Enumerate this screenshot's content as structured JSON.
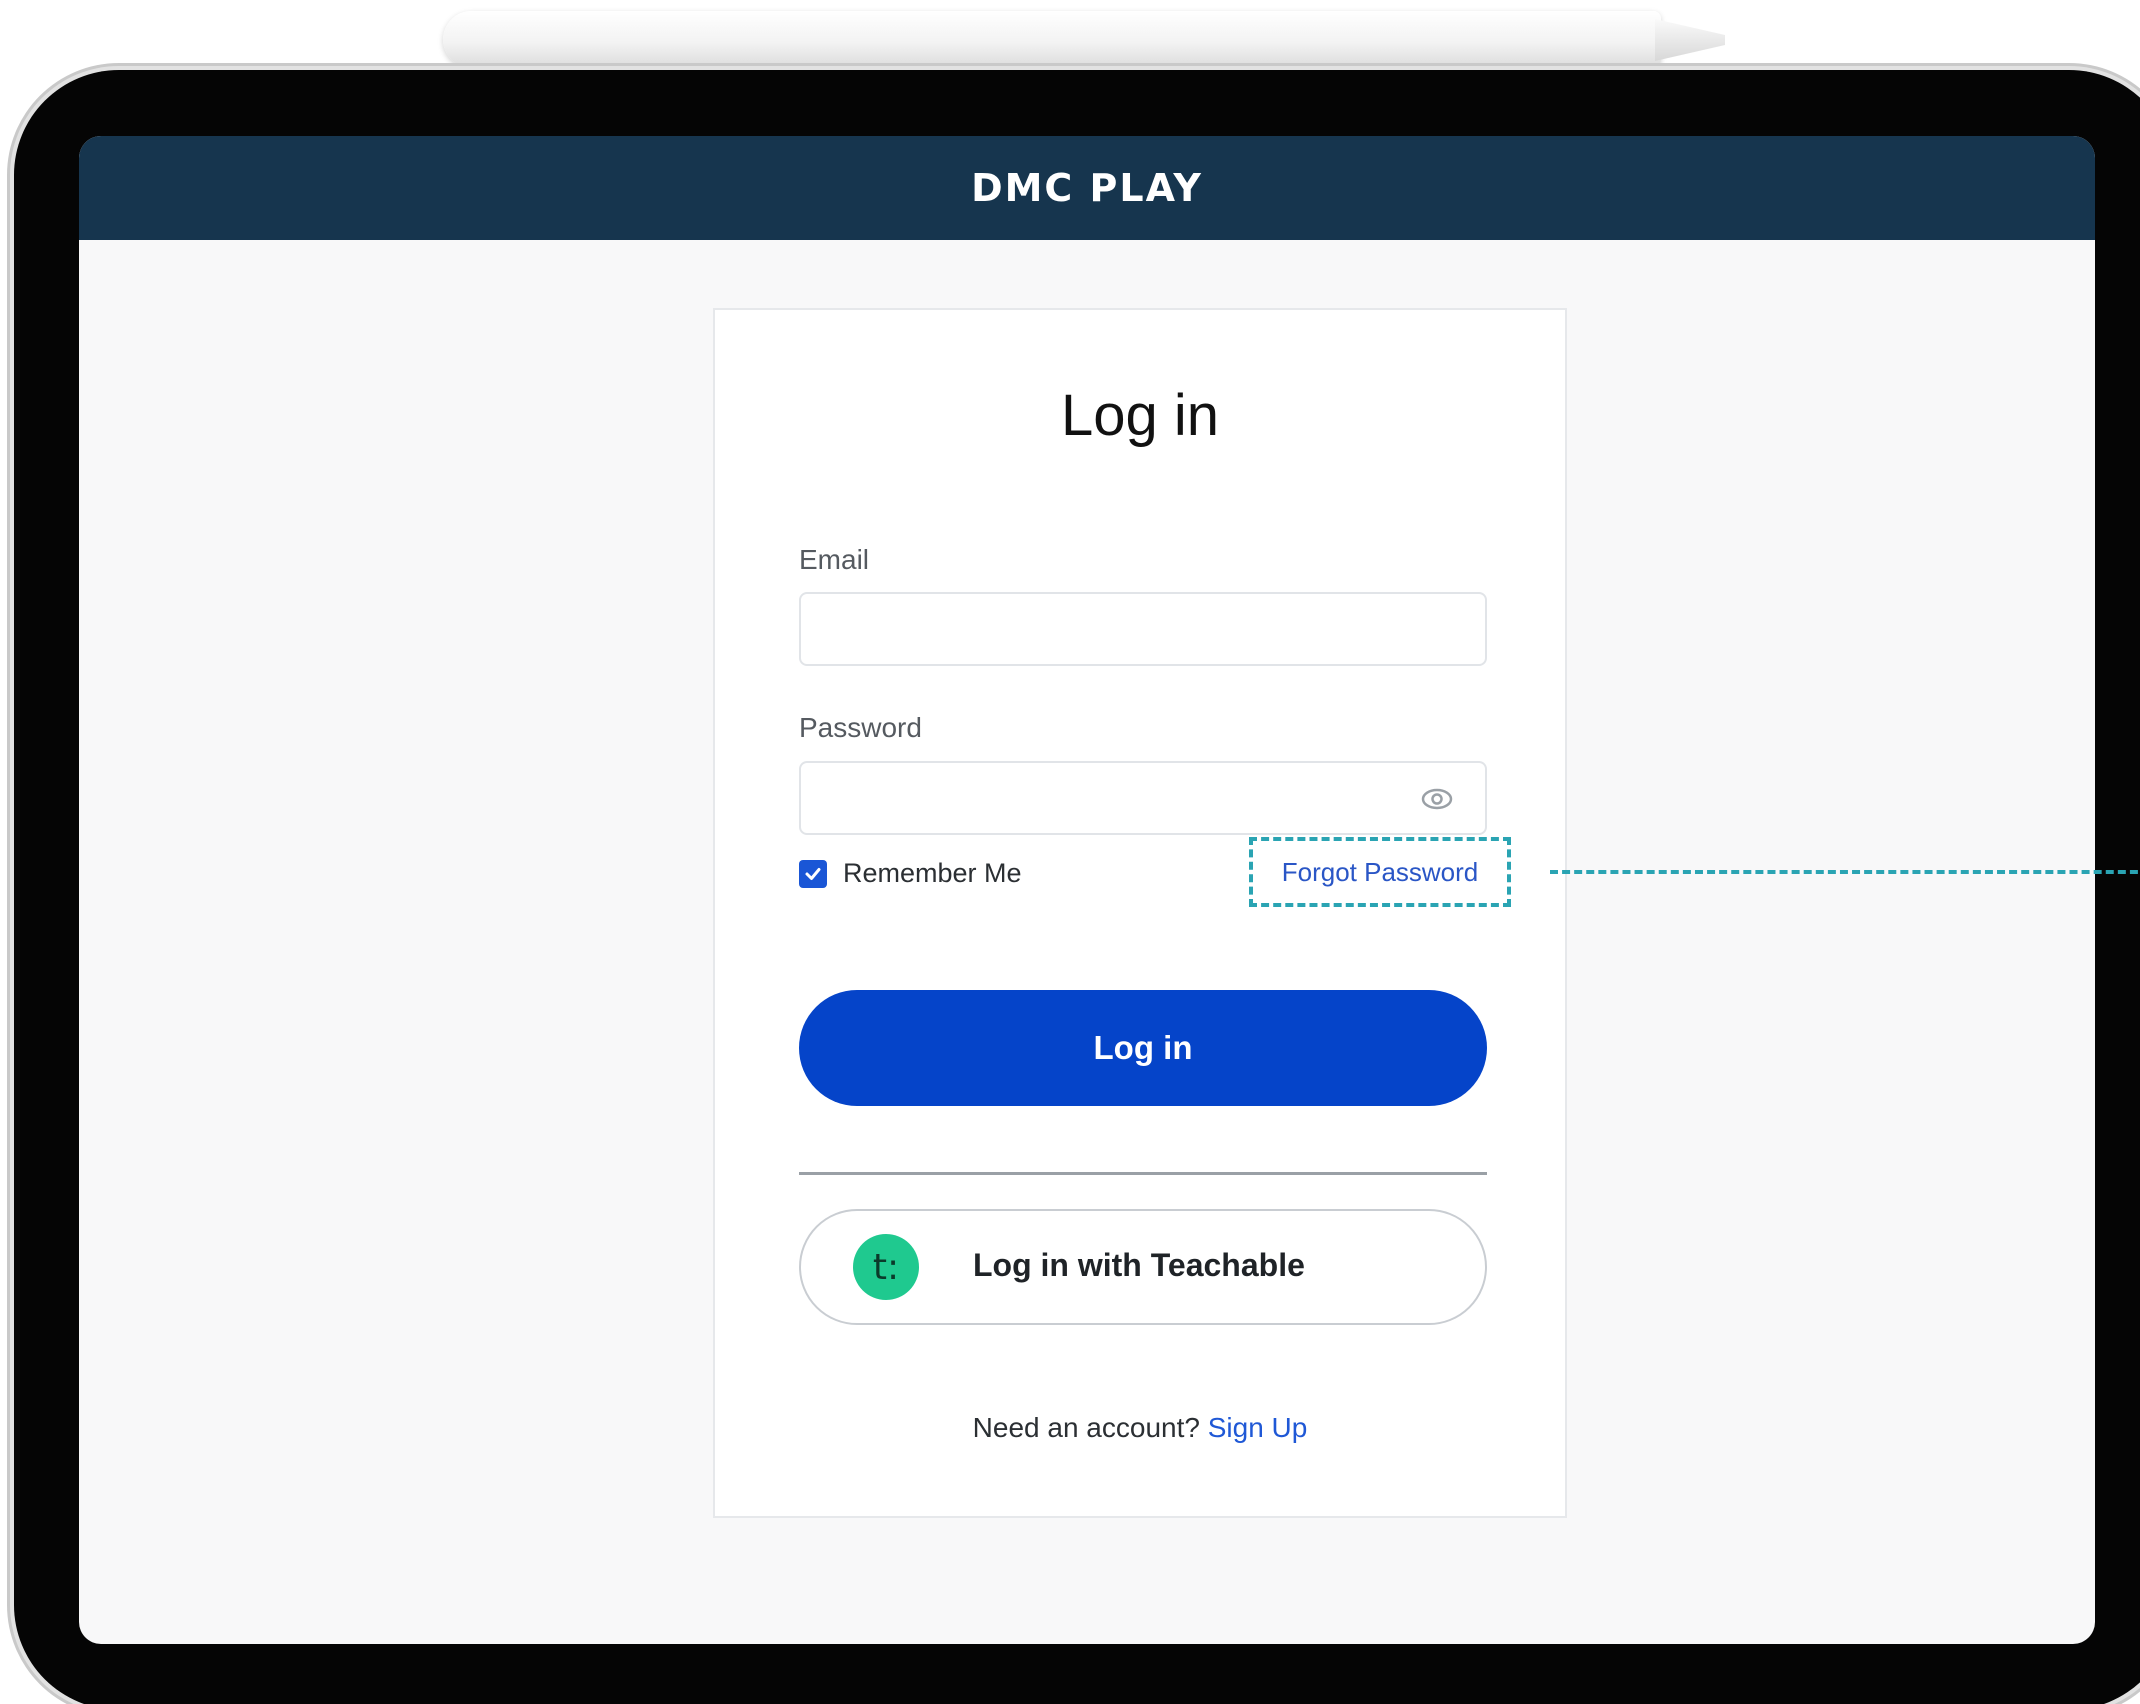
{
  "app": {
    "logo_text": "DMC PLAY"
  },
  "login_form": {
    "title": "Log in",
    "email_label": "Email",
    "email_value": "",
    "password_label": "Password",
    "password_value": "",
    "remember_me_label": "Remember Me",
    "remember_me_checked": true,
    "forgot_password_label": "Forgot Password",
    "login_button_label": "Log in",
    "teachable_icon_text": "t:",
    "teachable_button_label": "Log in with Teachable",
    "signup_prompt": "Need an account?",
    "signup_link_label": "Sign Up"
  },
  "colors": {
    "header_bg": "#16354e",
    "primary_button": "#0544c9",
    "link": "#1f58d6",
    "annotation": "#2aa4b3",
    "teachable_green": "#1fc98f"
  }
}
